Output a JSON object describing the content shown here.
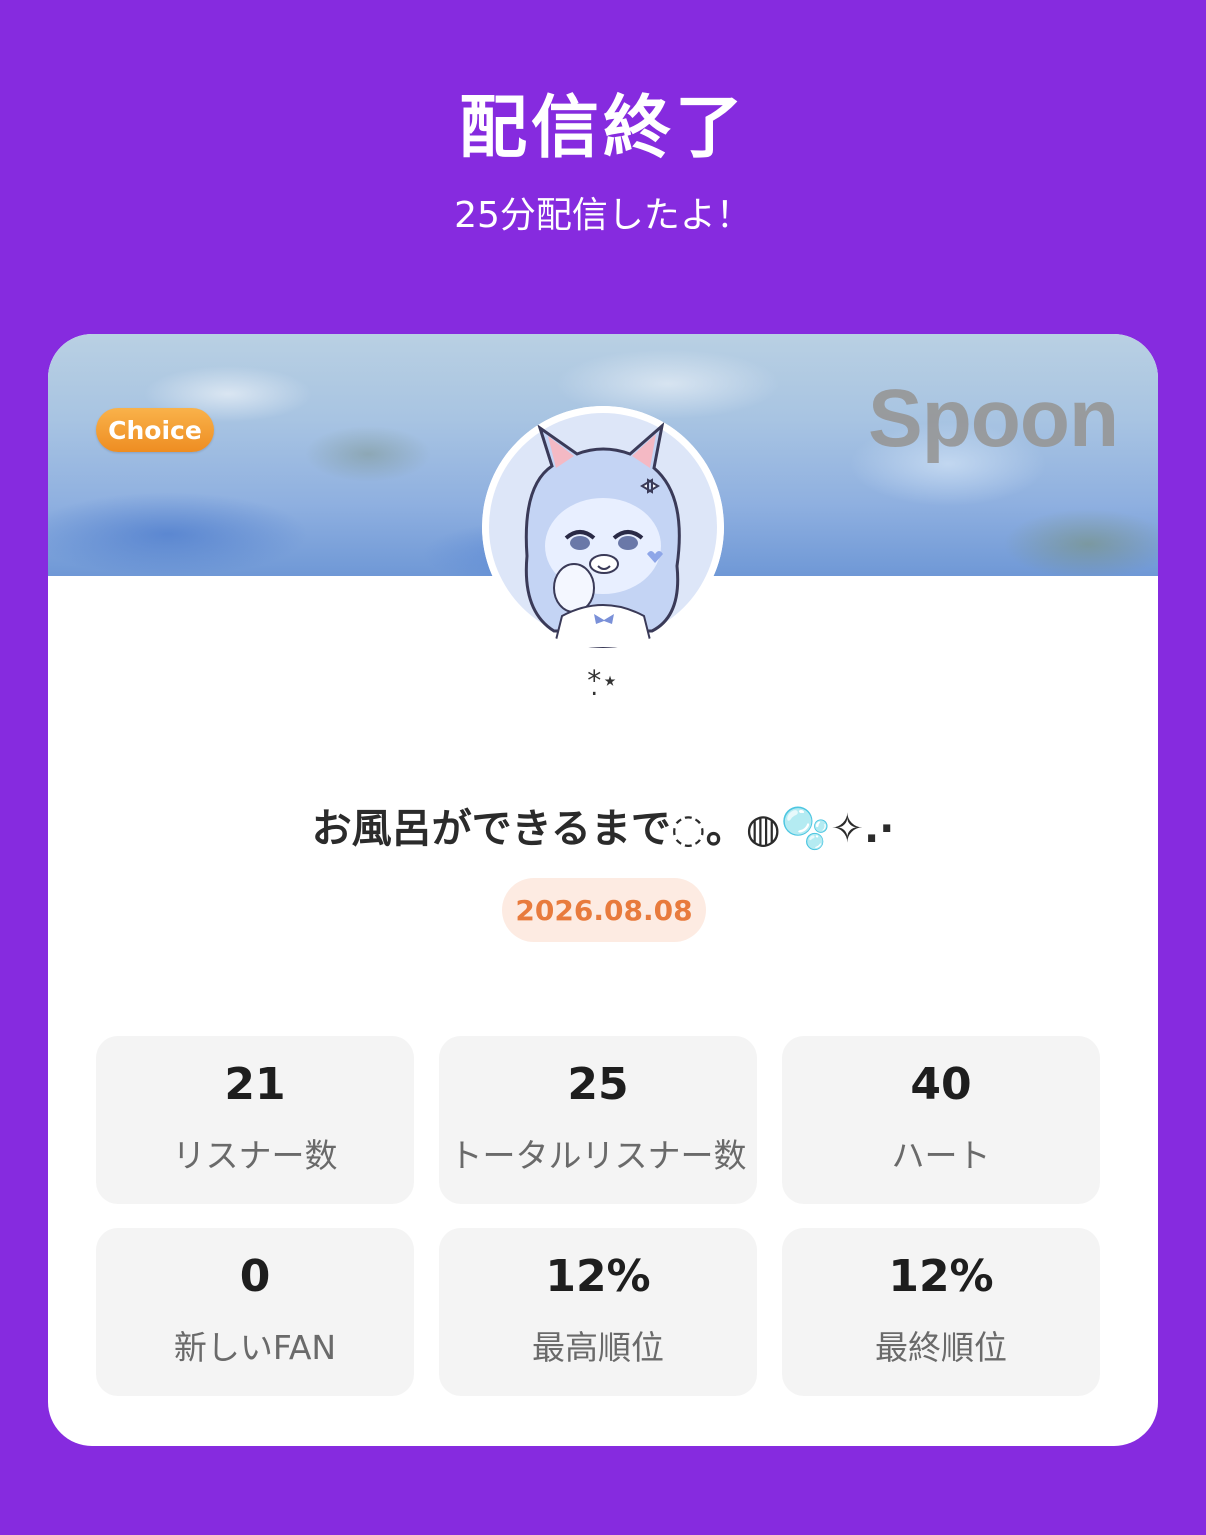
{
  "header": {
    "title": "配信終了",
    "subtitle": "25分配信したよ！"
  },
  "card": {
    "badge": "Choice",
    "brand": "Spoon",
    "nickname": "*̣⋆",
    "live_title": "お風呂ができるまで◌。◍🫧✧.·",
    "date": "2026.08.08",
    "stats": [
      {
        "value": "21",
        "label": "リスナー数"
      },
      {
        "value": "25",
        "label": "トータルリスナー数"
      },
      {
        "value": "40",
        "label": "ハート"
      },
      {
        "value": "0",
        "label": "新しいFAN"
      },
      {
        "value": "12%",
        "label": "最高順位"
      },
      {
        "value": "12%",
        "label": "最終順位"
      }
    ]
  },
  "colors": {
    "background": "#862bdf",
    "badge": "#f0962a",
    "date_text": "#e87b3d",
    "date_bg": "#fdebe2"
  },
  "icons": {
    "avatar": "white-cat-girl-avatar"
  }
}
